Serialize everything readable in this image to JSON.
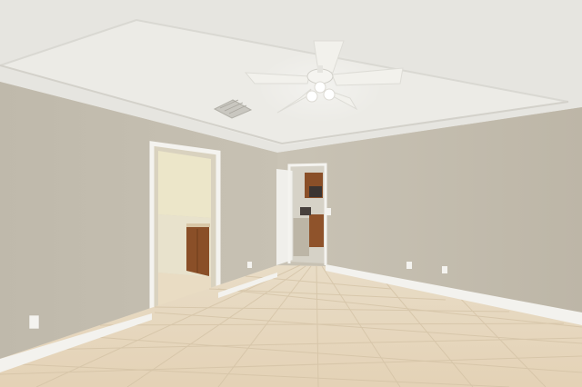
{
  "scene": {
    "subject": "empty-room-interior",
    "colors": {
      "ceiling": "#e9e8e3",
      "wall": "#c2bcae",
      "wall_shadow": "#b6af9f",
      "baseboard": "#f3f2ee",
      "floor": "#e3d2b8",
      "grout": "#cdbb9e",
      "cabinet": "#8a4f28",
      "door_white": "#f0efeb",
      "fan_blade": "#f2f1ec"
    }
  }
}
